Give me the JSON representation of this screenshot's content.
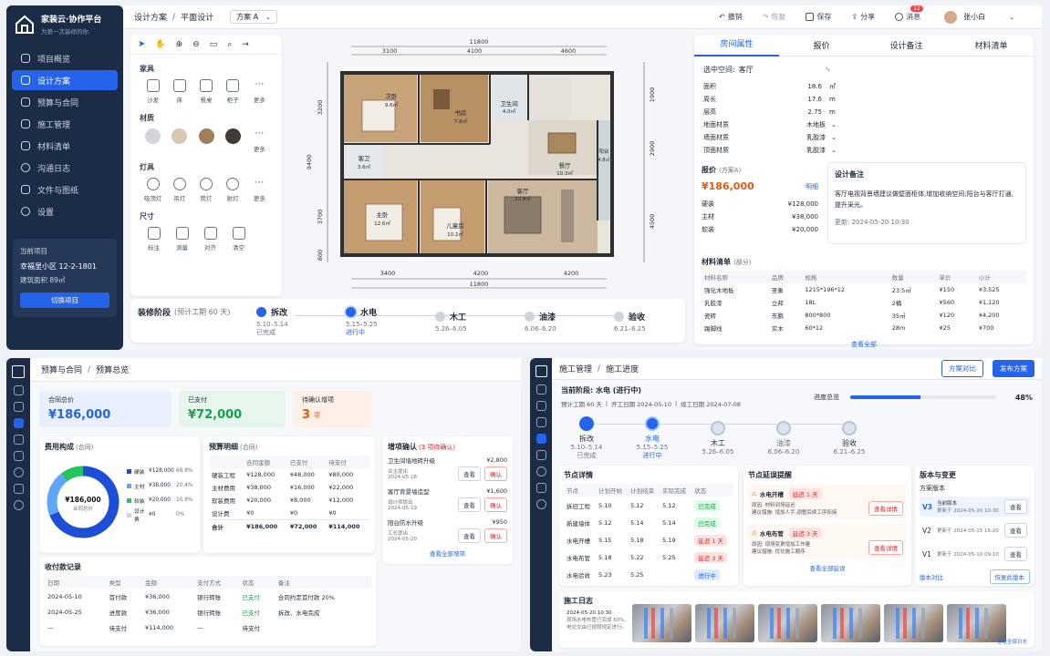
{
  "brand": {
    "name": "家装云·协作平台",
    "tagline": "为第一次装修的你"
  },
  "sidebar": {
    "items": [
      "项目概览",
      "设计方案",
      "预算与合同",
      "施工管理",
      "材料清单",
      "沟通日志",
      "文件与图纸",
      "设置"
    ],
    "active": 1
  },
  "project": {
    "label": "当前项目",
    "name": "幸福里小区 12-2-1801",
    "area": "建筑面积 89㎡",
    "switch": "切换项目"
  },
  "topbar": {
    "crumb1": "设计方案",
    "crumb2": "平面设计",
    "plan": "方案 A",
    "undo": "撤销",
    "redo": "恢复",
    "save": "保存",
    "share": "分享",
    "msg": "消息",
    "msg_count": "12",
    "user": "张小白"
  },
  "tools": {
    "furniture": {
      "title": "家具",
      "items": [
        "沙发",
        "床",
        "餐桌",
        "柜子",
        "更多"
      ]
    },
    "material": {
      "title": "材质",
      "items": [
        "更多"
      ]
    },
    "lights": {
      "title": "灯具",
      "items": [
        "吸顶灯",
        "吊灯",
        "筒灯",
        "射灯",
        "更多"
      ]
    },
    "dims": {
      "title": "尺寸",
      "items": [
        "标注",
        "测量",
        "对齐",
        "清空"
      ]
    }
  },
  "floorplan": {
    "top_total": "11800",
    "top": [
      "3100",
      "4100",
      "4600"
    ],
    "bottom_total": "11800",
    "bottom": [
      "3400",
      "4200",
      "4200"
    ],
    "left": [
      "3200",
      "9400",
      "3700",
      "800"
    ],
    "right": [
      "1900",
      "2900",
      "4500"
    ],
    "rooms": [
      {
        "name": "次卧",
        "area": "9.6㎡"
      },
      {
        "name": "书房",
        "area": "7.8㎡"
      },
      {
        "name": "卫生间",
        "area": "4.0㎡"
      },
      {
        "name": "阳台",
        "area": "4.8㎡"
      },
      {
        "name": "餐厅",
        "area": "10.3㎡"
      },
      {
        "name": "客卫",
        "area": "3.6㎡"
      },
      {
        "name": "主卧",
        "area": "12.6㎡"
      },
      {
        "name": "儿童房",
        "area": "10.2㎡"
      },
      {
        "name": "客厅",
        "area": "22.8㎡"
      }
    ]
  },
  "stages": {
    "title": "装修阶段",
    "note": "(预计工期 60 天)",
    "items": [
      {
        "name": "拆改",
        "date": "5.10–5.14",
        "status": "已完成",
        "state": "done"
      },
      {
        "name": "水电",
        "date": "5.15–5.25",
        "status": "进行中",
        "state": "cur"
      },
      {
        "name": "木工",
        "date": "5.26–6.05",
        "status": "",
        "state": "todo"
      },
      {
        "name": "油漆",
        "date": "6.06–6.20",
        "status": "",
        "state": "todo"
      },
      {
        "name": "验收",
        "date": "6.21–6.25",
        "status": "",
        "state": "todo"
      }
    ]
  },
  "props": {
    "tabs": [
      "房间属性",
      "报价",
      "设计备注",
      "材料清单"
    ],
    "selected_label": "选中空间:",
    "selected": "客厅",
    "fields": [
      {
        "k": "面积",
        "v": "18.6",
        "u": "㎡"
      },
      {
        "k": "周长",
        "v": "17.6",
        "u": "m"
      },
      {
        "k": "层高",
        "v": "2.75",
        "u": "m"
      }
    ],
    "mats": [
      {
        "k": "地面材质",
        "v": "木地板"
      },
      {
        "k": "墙面材质",
        "v": "乳胶漆"
      },
      {
        "k": "顶面材质",
        "v": "乳胶漆"
      }
    ]
  },
  "quote": {
    "title": "报价",
    "plan": "(方案A)",
    "total": "¥186,000",
    "detail": "明细",
    "items": [
      {
        "k": "硬装",
        "v": "¥128,000"
      },
      {
        "k": "主材",
        "v": "¥38,000"
      },
      {
        "k": "软装",
        "v": "¥20,000"
      }
    ]
  },
  "design_note": {
    "title": "设计备注",
    "text": "客厅电视背景墙建议做壁面柜体,增加收纳空间;阳台与客厅打通,提升采光。",
    "time": "更新: 2024-05-20 10:30"
  },
  "materials": {
    "title": "材料清单",
    "note": "(部分)",
    "headers": [
      "材料名称",
      "品牌",
      "规格",
      "数量",
      "单价",
      "小计"
    ],
    "rows": [
      [
        "强化木地板",
        "圣象",
        "1215*196*12",
        "23.5㎡",
        "¥150",
        "¥3,525"
      ],
      [
        "乳胶漆",
        "立邦",
        "18L",
        "2桶",
        "¥560",
        "¥1,120"
      ],
      [
        "瓷砖",
        "东鹏",
        "800*800",
        "35㎡",
        "¥120",
        "¥4,200"
      ],
      [
        "踢脚线",
        "实木",
        "60*12",
        "28m",
        "¥25",
        "¥700"
      ]
    ],
    "more": "查看全部"
  },
  "budget": {
    "crumb1": "预算与合同",
    "crumb2": "预算总览",
    "kpis": [
      {
        "label": "合同总价",
        "value": "¥186,000"
      },
      {
        "label": "已支付",
        "value": "¥72,000"
      },
      {
        "label": "待确认增项",
        "value": "3",
        "unit": "项"
      }
    ],
    "pie": {
      "title": "费用构成",
      "note": "(合同)",
      "center_value": "¥186,000",
      "center_label": "合同总价",
      "legend": [
        {
          "name": "硬装",
          "value": "¥128,000",
          "pct": "68.8%",
          "color": "#1d4ed8"
        },
        {
          "name": "主材",
          "value": "¥38,000",
          "pct": "20.4%",
          "color": "#60a5fa"
        },
        {
          "name": "软装",
          "value": "¥20,000",
          "pct": "10.8%",
          "color": "#22c55e"
        },
        {
          "name": "设计费",
          "value": "¥0",
          "pct": "0%",
          "color": "#cbd5e1"
        }
      ]
    },
    "detail": {
      "title": "预算明细",
      "note": "(合同)",
      "headers": [
        "",
        "合同金额",
        "已支付",
        "待支付"
      ],
      "rows": [
        [
          "硬装工程",
          "¥128,000",
          "¥48,000",
          "¥80,000"
        ],
        [
          "主材费用",
          "¥38,000",
          "¥16,000",
          "¥22,000"
        ],
        [
          "软装费用",
          "¥20,000",
          "¥8,000",
          "¥12,000"
        ],
        [
          "设计费",
          "¥0",
          "¥0",
          "¥0"
        ]
      ],
      "total": [
        "合计",
        "¥186,000",
        "¥72,000",
        "¥114,000"
      ]
    },
    "addons": {
      "title": "增项确认",
      "note": "(3 项待确认)",
      "items": [
        {
          "name": "卫生间墙地砖升级",
          "amount": "¥2,800",
          "by": "业主提出",
          "date": "2024-05-18"
        },
        {
          "name": "客厅背景墙造型",
          "amount": "¥1,600",
          "by": "设计师提出",
          "date": "2024-05-19"
        },
        {
          "name": "阳台防水升级",
          "amount": "¥950",
          "by": "工长提出",
          "date": "2024-05-20"
        }
      ],
      "view": "查看",
      "confirm": "确认",
      "more": "查看全部增项"
    },
    "payments": {
      "title": "收付款记录",
      "headers": [
        "日期",
        "类型",
        "金额",
        "支付方式",
        "状态",
        "备注"
      ],
      "rows": [
        [
          "2024-05-10",
          "首付款",
          "¥36,000",
          "银行转账",
          "已支付",
          "合同约定首付款 20%"
        ],
        [
          "2024-05-25",
          "进度款",
          "¥36,000",
          "银行转账",
          "已支付",
          "拆改、水电完成"
        ],
        [
          "—",
          "待支付",
          "¥114,000",
          "—",
          "待支付",
          ""
        ]
      ]
    }
  },
  "construction": {
    "crumb1": "施工管理",
    "crumb2": "施工进度",
    "compare": "方案对比",
    "publish": "发布方案",
    "stage_title": "当前阶段: 水电 (进行中)",
    "period": "预计工期 60 天",
    "start": "开工日期 2024-05-10",
    "end": "竣工日期 2024-07-08",
    "progress_label": "进度总览",
    "progress_value": 0.48,
    "progress_text": "48%",
    "stages": [
      {
        "name": "拆改",
        "date": "5.10–5.14",
        "status": "已完成",
        "state": "done"
      },
      {
        "name": "水电",
        "date": "5.15–5.25",
        "status": "进行中",
        "state": "cur"
      },
      {
        "name": "木工",
        "date": "5.26–6.05",
        "status": "",
        "state": "todo"
      },
      {
        "name": "油漆",
        "date": "6.06–6.20",
        "status": "",
        "state": "todo"
      },
      {
        "name": "验收",
        "date": "6.21–6.25",
        "status": "",
        "state": "todo"
      }
    ],
    "nodes": {
      "title": "节点详情",
      "headers": [
        "节点",
        "计划开始",
        "计划结束",
        "实际完成",
        "状态"
      ],
      "rows": [
        [
          "拆旧工程",
          "5.10",
          "5.12",
          "5.12",
          "已完成"
        ],
        [
          "新建墙体",
          "5.12",
          "5.14",
          "5.14",
          "已完成"
        ],
        [
          "水电开槽",
          "5.15",
          "5.18",
          "5.19",
          "延迟 1 天"
        ],
        [
          "水电布管",
          "5.18",
          "5.22",
          "5.25",
          "延迟 3 天"
        ],
        [
          "水电验收",
          "5.23",
          "5.25",
          "",
          "进行中"
        ]
      ]
    },
    "delays": {
      "title": "节点延误提醒",
      "items": [
        {
          "name": "水电开槽",
          "tag": "延迟 1 天",
          "reason": "原因: 材料到场延迟",
          "advice": "建议措施: 增加人手,调整后续工序衔接"
        },
        {
          "name": "水电布管",
          "tag": "延迟 3 天",
          "reason": "原因: 现场变更增加工作量",
          "advice": "建议措施: 优化施工顺序"
        }
      ],
      "btn": "查看详情",
      "more": "查看全部延误"
    },
    "versions": {
      "title": "版本与变更",
      "subtitle": "方案版本",
      "items": [
        {
          "tag": "V3",
          "name": "当前版本",
          "time": "更新于 2024-05-20 10:30"
        },
        {
          "tag": "V2",
          "name": "",
          "time": "更新于 2024-05-15 16:20"
        },
        {
          "tag": "V1",
          "name": "",
          "time": "更新于 2024-05-10 09:10"
        }
      ],
      "view": "查看",
      "compare": "版本对比",
      "restore": "恢复此版本"
    },
    "log": {
      "title": "施工日志",
      "time": "2024-05-20 10:30",
      "text": "现场水电布管已完成 60%,电交交由已按照规定进行。",
      "more": "查看全部日志"
    }
  }
}
